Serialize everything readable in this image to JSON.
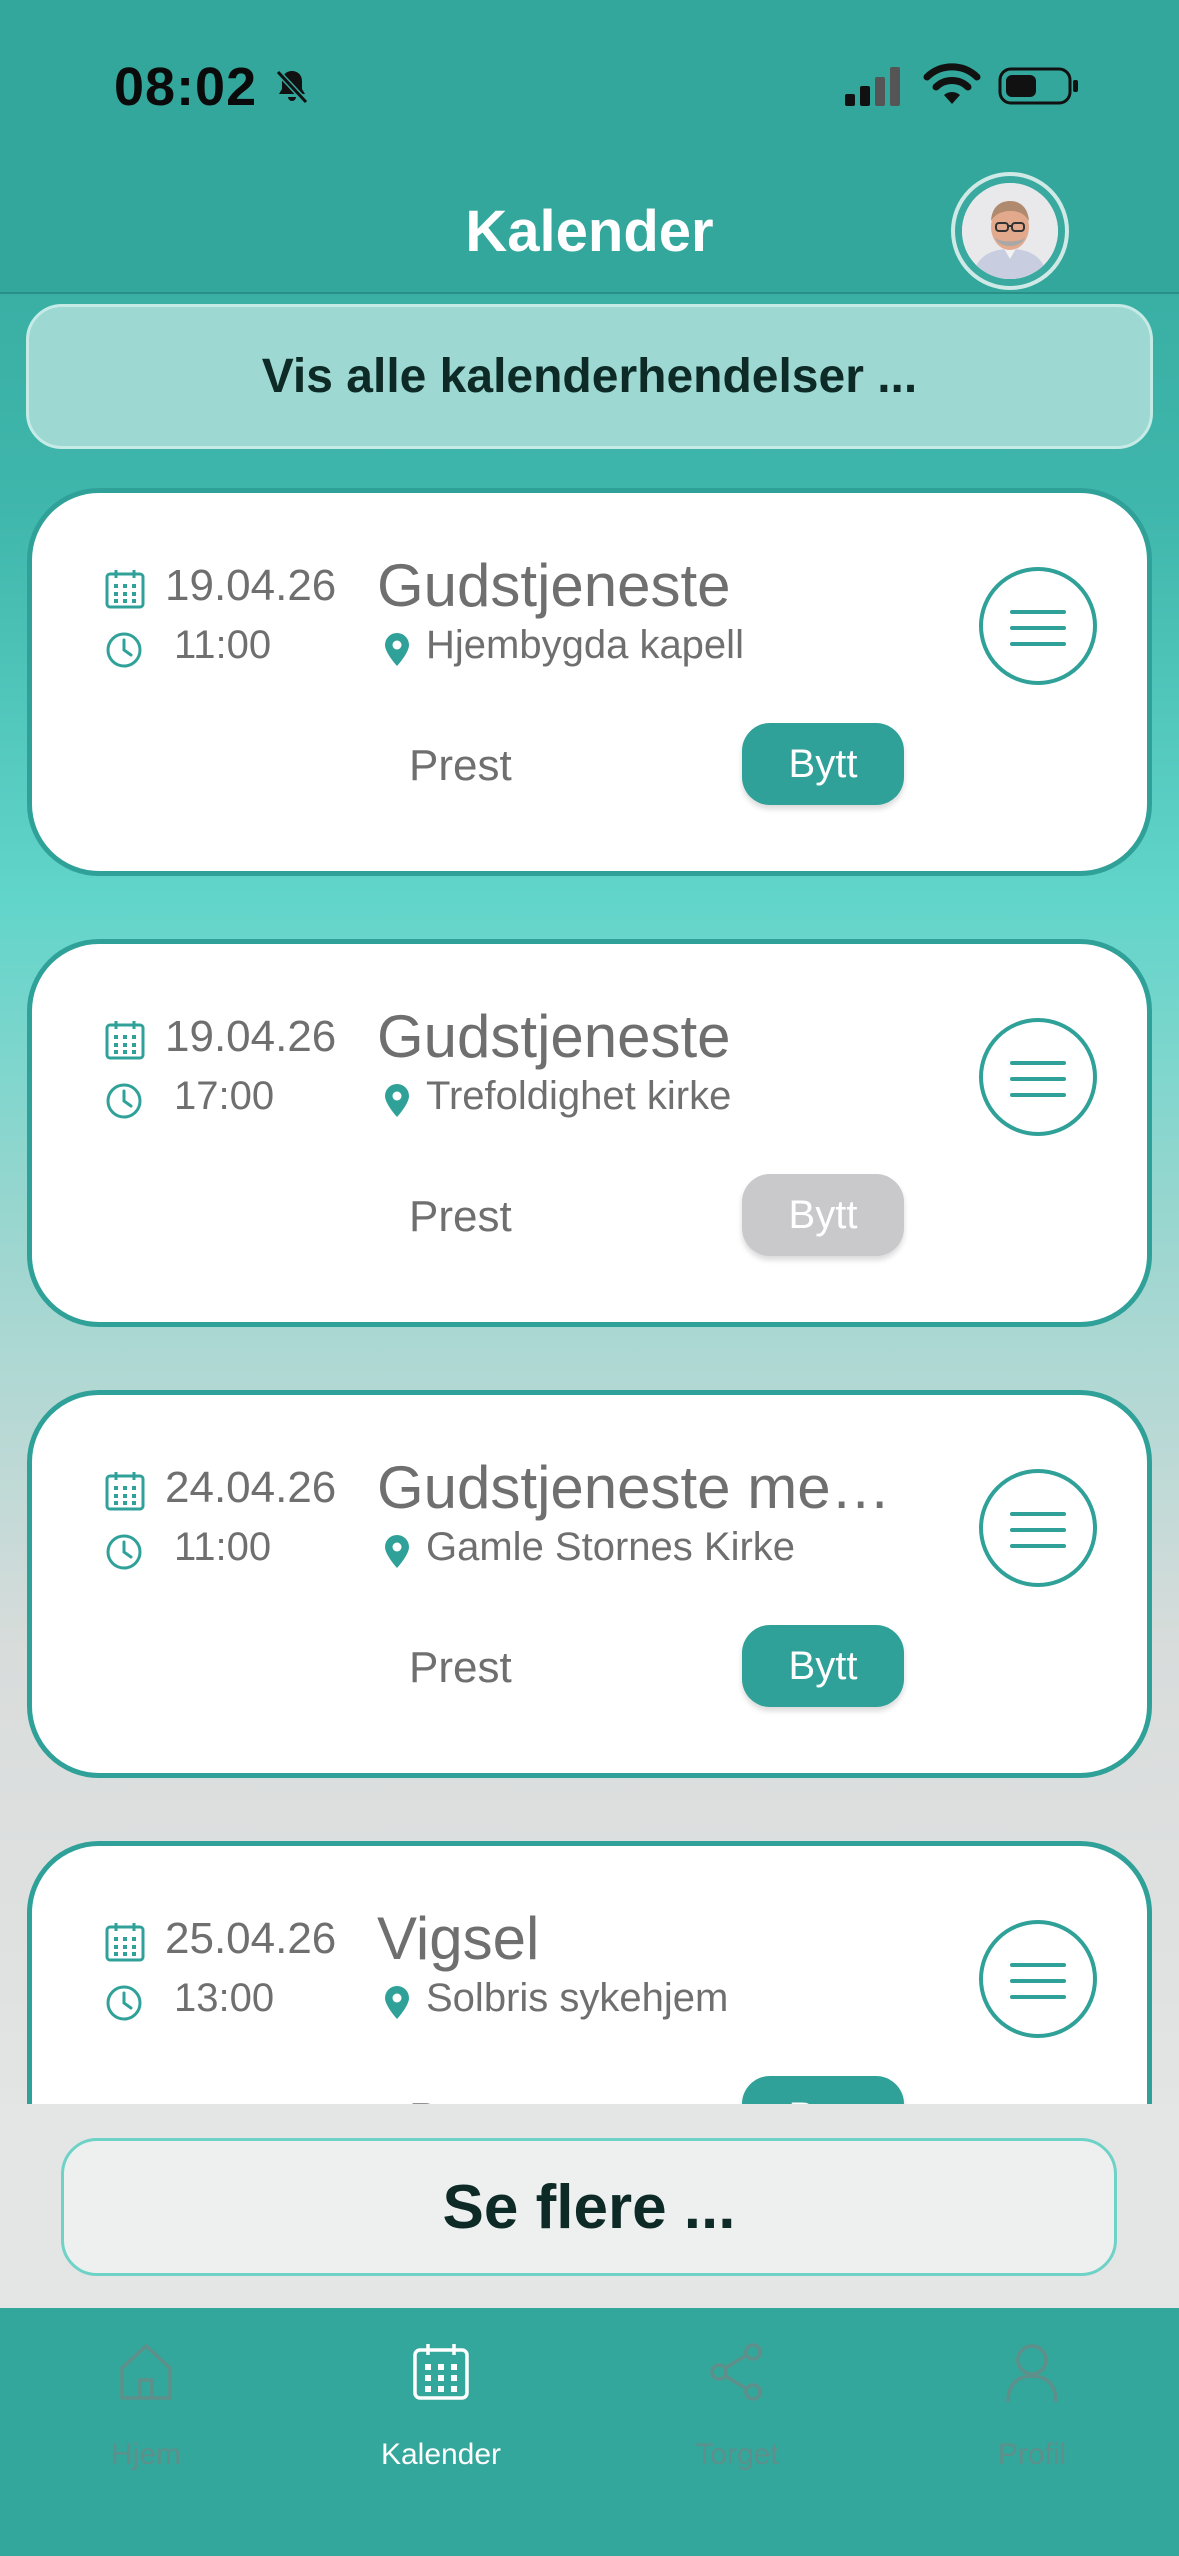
{
  "status_bar": {
    "time": "08:02"
  },
  "header": {
    "title": "Kalender"
  },
  "show_all": {
    "label": "Vis alle kalenderhendelser ..."
  },
  "events": [
    {
      "date": "19.04.26",
      "time": "11:00",
      "title": "Gudstjeneste",
      "location": "Hjembygda kapell",
      "role": "Prest",
      "swap_label": "Bytt",
      "swap_enabled": true
    },
    {
      "date": "19.04.26",
      "time": "17:00",
      "title": "Gudstjeneste",
      "location": "Trefoldighet kirke",
      "role": "Prest",
      "swap_label": "Bytt",
      "swap_enabled": false
    },
    {
      "date": "24.04.26",
      "time": "11:00",
      "title": "Gudstjeneste me…",
      "location": "Gamle Stornes Kirke",
      "role": "Prest",
      "swap_label": "Bytt",
      "swap_enabled": true
    },
    {
      "date": "25.04.26",
      "time": "13:00",
      "title": "Vigsel",
      "location": "Solbris sykehjem",
      "role": "Prest",
      "swap_label": "Bytt",
      "swap_enabled": true
    }
  ],
  "see_more": {
    "label": "Se flere ..."
  },
  "tabs": [
    {
      "label": "Hjem",
      "icon": "home-icon",
      "active": false
    },
    {
      "label": "Kalender",
      "icon": "calendar-icon",
      "active": true
    },
    {
      "label": "Torget",
      "icon": "share-icon",
      "active": false
    },
    {
      "label": "Profil",
      "icon": "profile-icon",
      "active": false
    }
  ],
  "colors": {
    "teal": "#33a79c",
    "accent": "#2fa198",
    "disabled": "#c9c9cc"
  }
}
